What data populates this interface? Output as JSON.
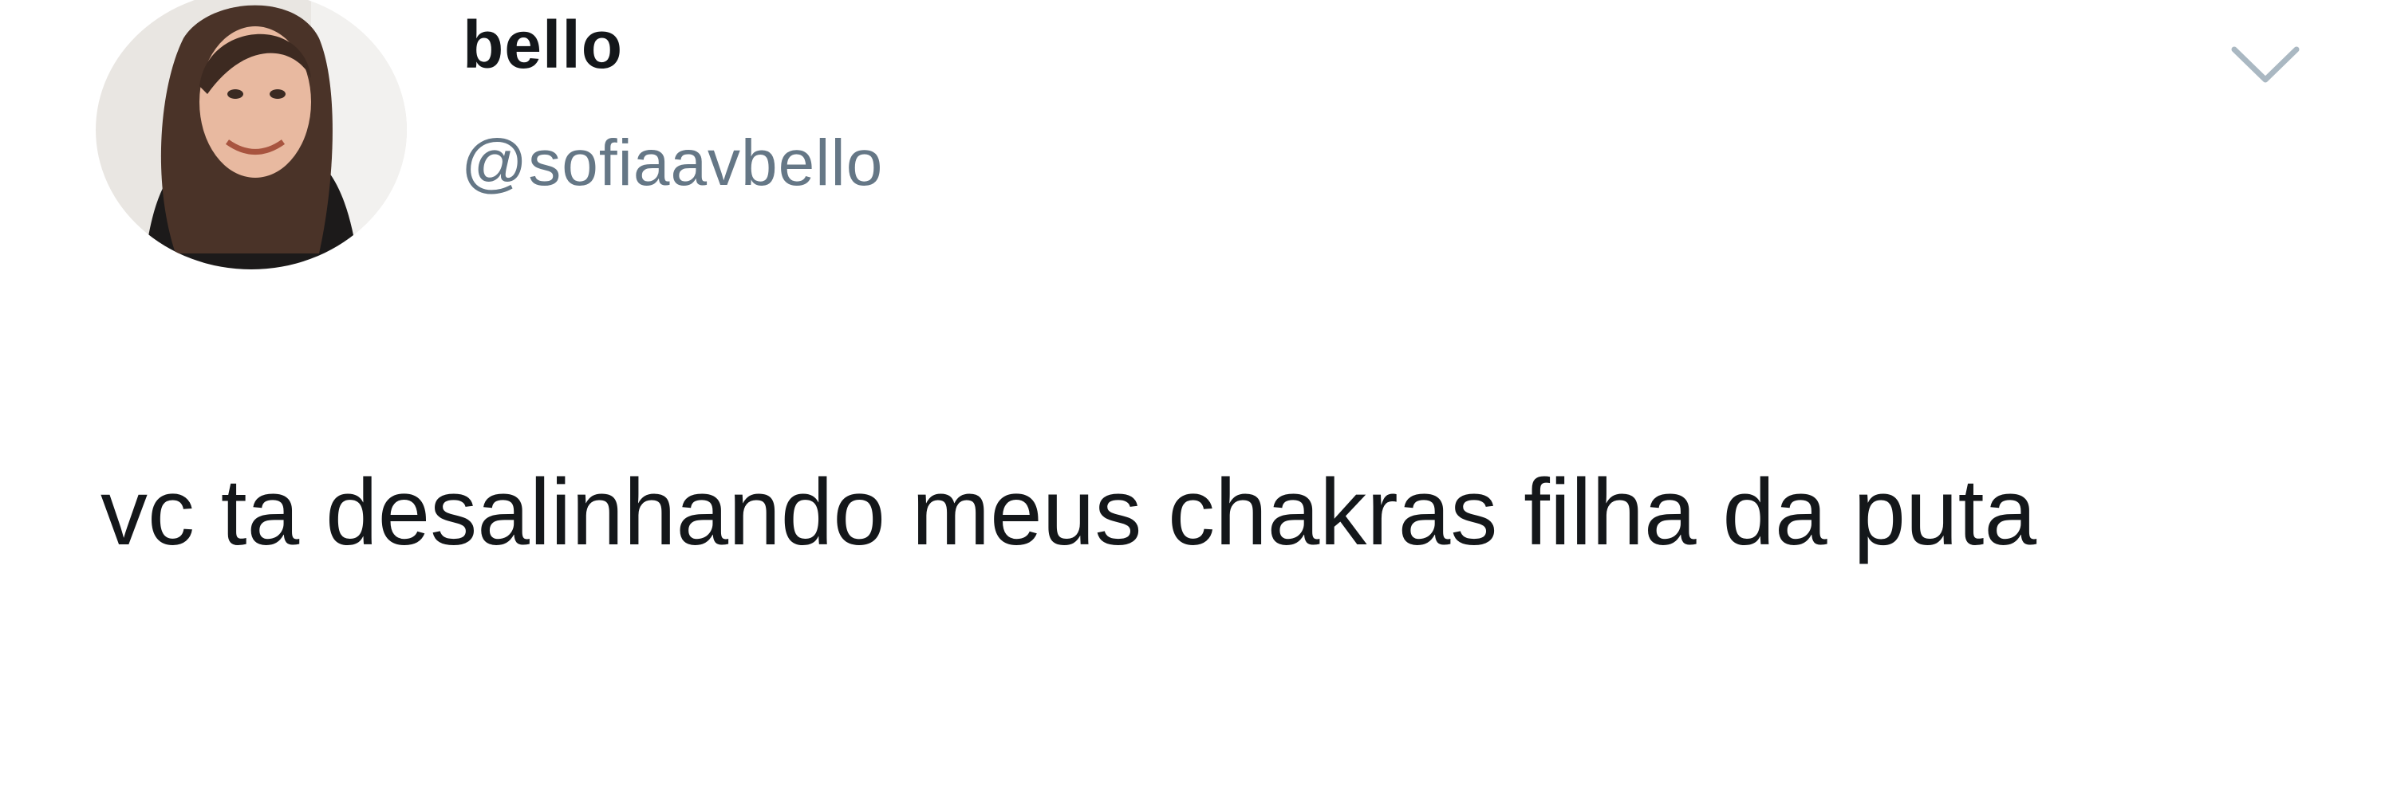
{
  "user": {
    "display_name": "bello",
    "handle": "@sofiaavbello",
    "avatar_icon": "profile-photo"
  },
  "tweet": {
    "text": "vc ta desalinhando meus chakras filha da puta"
  },
  "menu": {
    "icon": "chevron-down-icon"
  },
  "colors": {
    "background": "#ffffff",
    "name": "#14171a",
    "handle": "#657786",
    "chevron": "#aab8c2"
  }
}
